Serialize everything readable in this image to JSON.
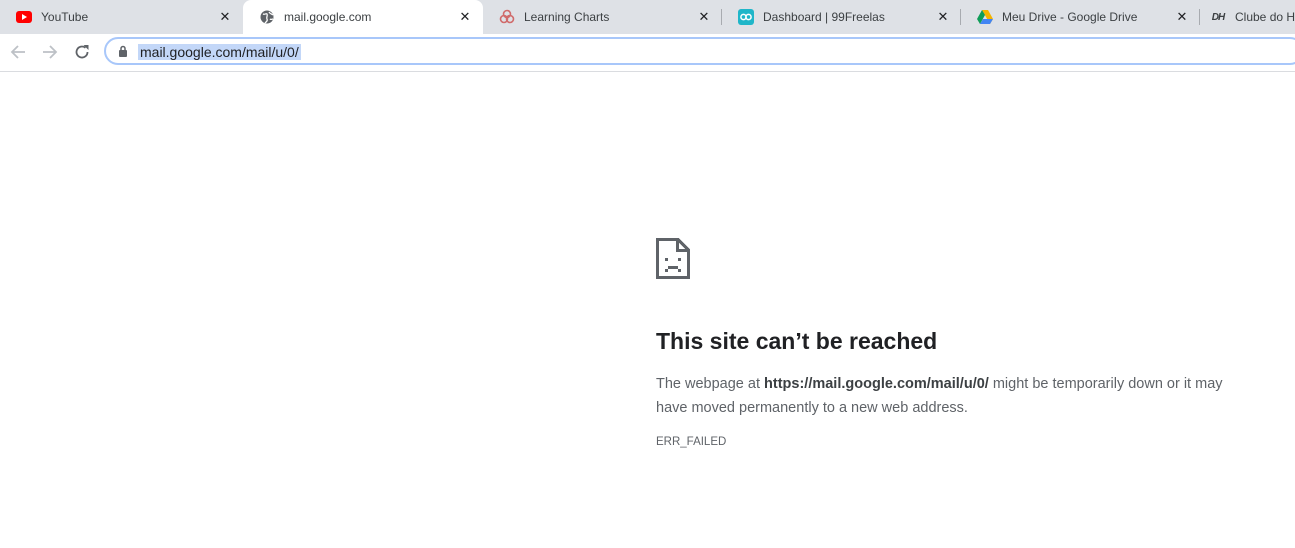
{
  "tabs": [
    {
      "title": "YouTube",
      "icon": "youtube-icon",
      "active": false
    },
    {
      "title": "mail.google.com",
      "icon": "globe-icon",
      "active": true
    },
    {
      "title": "Learning Charts",
      "icon": "learning-charts-icon",
      "active": false
    },
    {
      "title": "Dashboard | 99Freelas",
      "icon": "99freelas-icon",
      "active": false
    },
    {
      "title": "Meu Drive - Google Drive",
      "icon": "google-drive-icon",
      "active": false
    },
    {
      "title": "Clube do H",
      "icon": "clube-logo-icon",
      "active": false
    }
  ],
  "favicon_logo_text": "DH",
  "close_glyph": "✕",
  "toolbar": {
    "url": "mail.google.com/mail/u/0/"
  },
  "error": {
    "heading": "This site can’t be reached",
    "desc_prefix": "The webpage at ",
    "desc_url": "https://mail.google.com/mail/u/0/",
    "desc_suffix": " might be temporarily down or it may have moved permanently to a new web address.",
    "code": "ERR_FAILED"
  },
  "colors": {
    "tabstrip": "#dee1e6",
    "youtube": "#ff0000",
    "drive_green": "#0f9d58",
    "drive_yellow": "#f4b400",
    "drive_blue": "#4285f4",
    "url_highlight": "#c3d7f8"
  }
}
